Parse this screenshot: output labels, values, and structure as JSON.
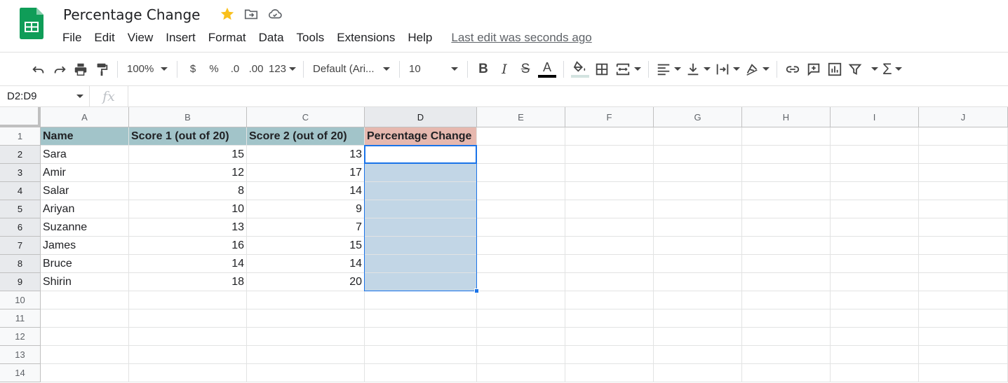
{
  "app": {
    "doc_title": "Percentage Change",
    "menus": [
      "File",
      "Edit",
      "View",
      "Insert",
      "Format",
      "Data",
      "Tools",
      "Extensions",
      "Help"
    ],
    "last_edit": "Last edit was seconds ago",
    "brand_color": "#0f9d58"
  },
  "toolbar": {
    "zoom": "100%",
    "currency": "$",
    "percent": "%",
    "decimal_decrease": ".0",
    "decimal_increase": ".00",
    "number_format": "123",
    "font": "Default (Ari...",
    "font_size": "10",
    "bold": "B",
    "italic": "I",
    "strike": "S",
    "text_color": "A",
    "sum": "Σ"
  },
  "formula_bar": {
    "name_box": "D2:D9",
    "fx": "fx",
    "value": ""
  },
  "sheet": {
    "columns": [
      "A",
      "B",
      "C",
      "D",
      "E",
      "F",
      "G",
      "H",
      "I",
      "J"
    ],
    "rows": [
      "1",
      "2",
      "3",
      "4",
      "5",
      "6",
      "7",
      "8",
      "9",
      "10",
      "11",
      "12",
      "13",
      "14"
    ],
    "headers": [
      "Name",
      "Score 1 (out of 20)",
      "Score 2 (out of 20)",
      "Percentage Change"
    ],
    "data": [
      [
        "Sara",
        "15",
        "13"
      ],
      [
        "Amir",
        "12",
        "17"
      ],
      [
        "Salar",
        "8",
        "14"
      ],
      [
        "Ariyan",
        "10",
        "9"
      ],
      [
        "Suzanne",
        "13",
        "7"
      ],
      [
        "James",
        "16",
        "15"
      ],
      [
        "Bruce",
        "14",
        "14"
      ],
      [
        "Shirin",
        "18",
        "20"
      ]
    ],
    "selected_range": "D2:D9",
    "header_fill_colors": [
      "#a2c4c9",
      "#a2c4c9",
      "#a2c4c9",
      "#e6b8af"
    ],
    "selection_color": "#1a73e8"
  }
}
